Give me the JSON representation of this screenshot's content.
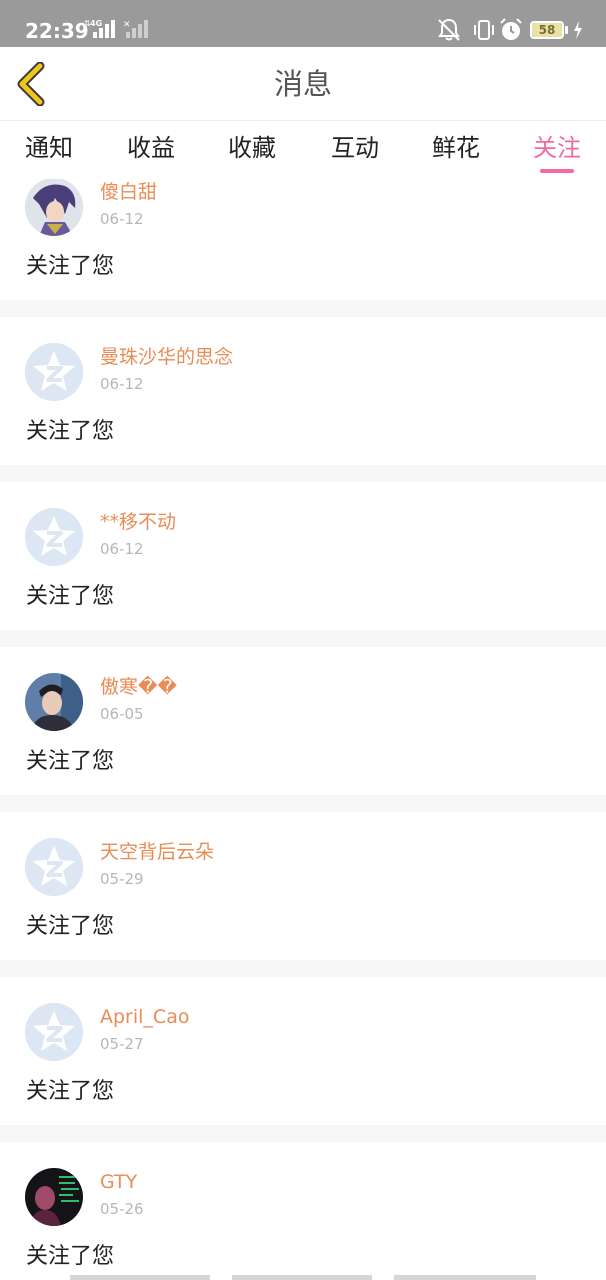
{
  "status_bar": {
    "time": "22:39",
    "network_label": "4G",
    "battery_level": "58"
  },
  "header": {
    "title": "消息"
  },
  "tabs": [
    {
      "label": "通知",
      "active": false
    },
    {
      "label": "收益",
      "active": false
    },
    {
      "label": "收藏",
      "active": false
    },
    {
      "label": "互动",
      "active": false
    },
    {
      "label": "鲜花",
      "active": false
    },
    {
      "label": "关注",
      "active": true
    }
  ],
  "colors": {
    "accent": "#f06aa3",
    "username": "#e98c55",
    "back_arrow": "#f0c41b"
  },
  "messages": [
    {
      "name": "傻白甜",
      "date": "06-12",
      "text": "关注了您",
      "avatar": "anime-avatar"
    },
    {
      "name": "曼珠沙华的思念",
      "date": "06-12",
      "text": "关注了您",
      "avatar": "default-avatar"
    },
    {
      "name": "**移不动",
      "date": "06-12",
      "text": "关注了您",
      "avatar": "default-avatar"
    },
    {
      "name": "傲寒��",
      "date": "06-05",
      "text": "关注了您",
      "avatar": "photo-avatar"
    },
    {
      "name": "天空背后云朵",
      "date": "05-29",
      "text": "关注了您",
      "avatar": "default-avatar"
    },
    {
      "name": "April_Cao",
      "date": "05-27",
      "text": "关注了您",
      "avatar": "default-avatar"
    },
    {
      "name": "GTY",
      "date": "05-26",
      "text": "关注了您",
      "avatar": "dark-photo-avatar"
    }
  ]
}
